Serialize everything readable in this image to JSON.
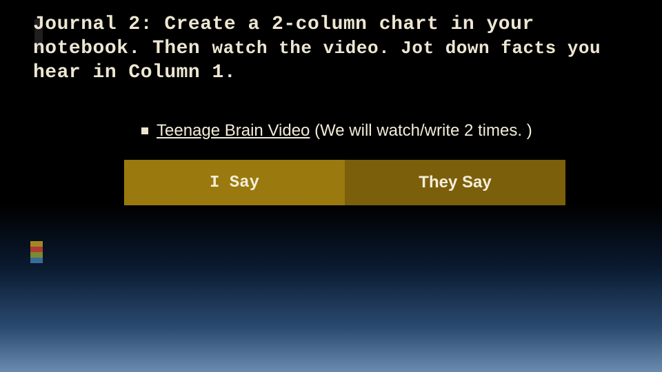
{
  "heading": {
    "line1a": "Journal 2:  Create a 2-column chart in your",
    "line2a": "notebook. Then ",
    "line2b": "watch the video.  Jot down facts you",
    "line3": "hear in Column 1."
  },
  "bullet": {
    "link_text": "Teenage Brain Video",
    "after": "  (We will watch/write 2 times. )"
  },
  "table": {
    "col1_header": "I Say",
    "col2_header": "They Say"
  },
  "stripes": [
    "#a28a1f",
    "#b03a3a",
    "#7a8a2f",
    "#3a6a9a"
  ]
}
